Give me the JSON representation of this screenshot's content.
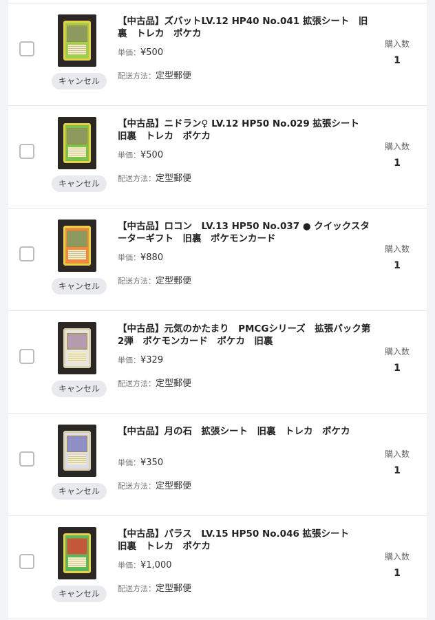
{
  "labels": {
    "unit_price": "単価：",
    "shipping": "配送方法：",
    "quantity": "購入数",
    "cancel": "キャンセル"
  },
  "items": [
    {
      "title": "【中古品】ズバットLV.12 HP40 No.041 拡張シート　旧裏　トレカ　ポケカ",
      "price": "¥500",
      "shipping": "定型郵便",
      "quantity": "1",
      "card_type": "grass",
      "card_color": "#9ed04d"
    },
    {
      "title": "【中古品】ニドラン♀ LV.12 HP50 No.029 拡張シート　旧裏　トレカ　ポケカ",
      "price": "¥500",
      "shipping": "定型郵便",
      "quantity": "1",
      "card_type": "grass",
      "card_color": "#7fc24a"
    },
    {
      "title": "【中古品】ロコン　LV.13 HP50 No.037 ● クイックスターターギフト　旧裏　ポケモンカード",
      "price": "¥880",
      "shipping": "定型郵便",
      "quantity": "1",
      "card_type": "fire",
      "card_color": "#f08a3c"
    },
    {
      "title": "【中古品】元気のかたまり　PMCGシリーズ　拡張パック第2弾　ポケモンカード　ポケカ　旧裏",
      "price": "¥329",
      "shipping": "定型郵便",
      "quantity": "1",
      "card_type": "trainer",
      "card_color": "#e9e6e0"
    },
    {
      "title": "【中古品】月の石　拡張シート　旧裏　トレカ　ポケカ",
      "price": "¥350",
      "shipping": "定型郵便",
      "quantity": "1",
      "card_type": "trainer",
      "card_color": "#dcdce6"
    },
    {
      "title": "【中古品】パラス　LV.15 HP50 No.046 拡張シート　　旧裏　トレカ　ポケカ",
      "price": "¥1,000",
      "shipping": "定型郵便",
      "quantity": "1",
      "card_type": "grass",
      "card_color": "#5fb55a"
    }
  ]
}
